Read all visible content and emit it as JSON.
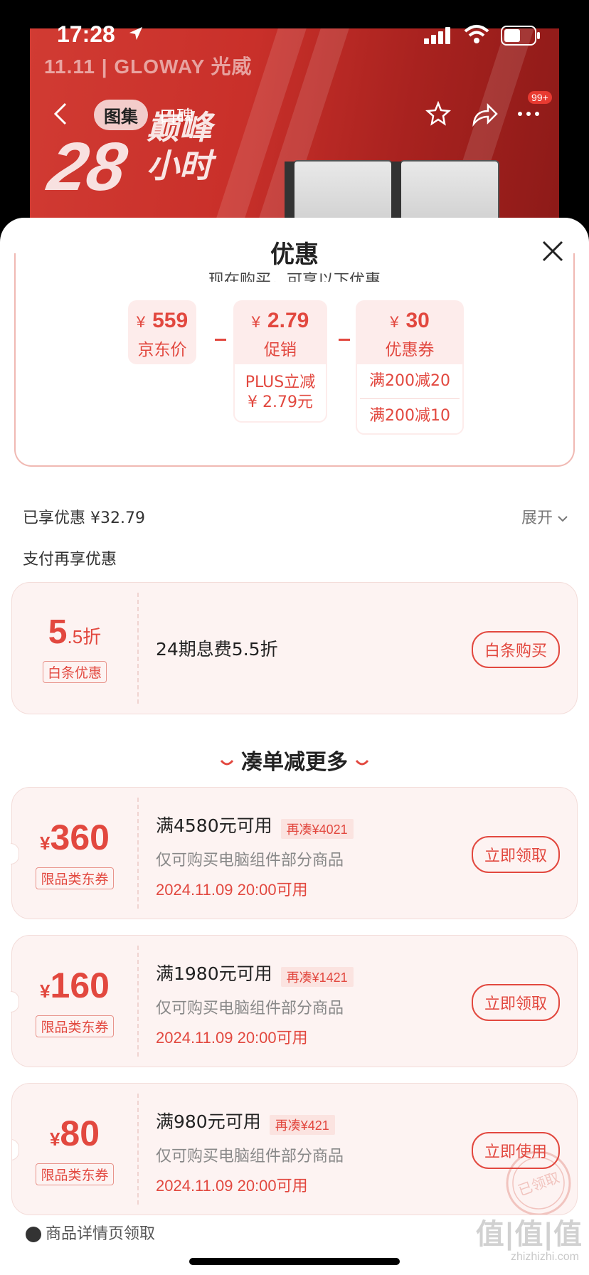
{
  "status_bar": {
    "time": "17:28"
  },
  "background": {
    "brand": "11.11 | GLOWAY 光威",
    "promo_number": "28",
    "promo_text": "巅峰小时",
    "nav_tabs": [
      "图集",
      "口碑"
    ],
    "badge": "99+"
  },
  "sheet": {
    "title": "优惠",
    "calc_hint": "现在购买，可享以下优惠",
    "price_items": [
      {
        "amount": "559",
        "label": "京东价"
      },
      {
        "amount": "2.79",
        "label": "促销",
        "details": [
          "PLUS立减",
          "¥ 2.79元"
        ]
      },
      {
        "amount": "30",
        "label": "优惠券",
        "details": [
          "满200减20",
          "满200减10"
        ]
      }
    ],
    "currency": "¥",
    "enjoyed": "已享优惠 ¥32.79",
    "expand": "展开",
    "pay_more": "支付再享优惠",
    "baitiao": {
      "discount_big": "5",
      "discount_small": ".5折",
      "tag": "白条优惠",
      "desc": "24期息费5.5折",
      "button": "白条购买"
    },
    "more_title": "凑单减更多",
    "coupons": [
      {
        "amount": "360",
        "tag": "限品类东券",
        "condition": "满4580元可用",
        "extra": "再凑¥4021",
        "scope": "仅可购买电脑组件部分商品",
        "date": "2024.11.09 20:00可用",
        "button": "立即领取"
      },
      {
        "amount": "160",
        "tag": "限品类东券",
        "condition": "满1980元可用",
        "extra": "再凑¥1421",
        "scope": "仅可购买电脑组件部分商品",
        "date": "2024.11.09 20:00可用",
        "button": "立即领取"
      },
      {
        "amount": "80",
        "tag": "限品类东券",
        "condition": "满980元可用",
        "extra": "再凑¥421",
        "scope": "仅可购买电脑组件部分商品",
        "date": "2024.11.09 20:00可用",
        "button": "立即使用",
        "stamp": "已领取"
      }
    ],
    "footer_note": "商品详情页领取",
    "watermark": "值|值|值",
    "watermark_sub": "zhizhizhi.com"
  },
  "colors": {
    "accent": "#e2483f",
    "coupon_bg": "#fdf3f2",
    "price_box_bg": "#fdeceb"
  }
}
